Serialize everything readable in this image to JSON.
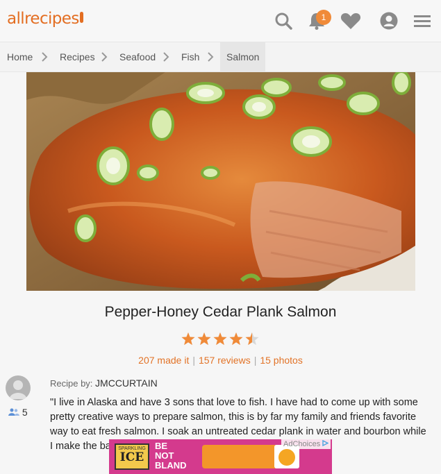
{
  "header": {
    "logo_text": "allrecipes",
    "notification_count": "1",
    "icons": [
      "search-icon",
      "bell-icon",
      "heart-icon",
      "user-icon",
      "menu-icon"
    ]
  },
  "breadcrumb": [
    {
      "label": "Home"
    },
    {
      "label": "Recipes"
    },
    {
      "label": "Seafood"
    },
    {
      "label": "Fish"
    },
    {
      "label": "Salmon"
    }
  ],
  "recipe": {
    "title": "Pepper-Honey Cedar Plank Salmon",
    "rating": 4.5,
    "made_it": "207 made it",
    "reviews": "157 reviews",
    "photos": "15 photos",
    "sep": "|",
    "byline_label": "Recipe by:",
    "author": "JMCCURTAIN",
    "followers": "5",
    "description": "\"I live in Alaska and have 3 sons that love to fish. I have had to come up with some pretty creative ways to prepare salmon, this is by far my family and friends favorite way to eat fresh salmon. I soak an untreated cedar plank in water and bourbon while I make the barbeque sauce so that's it is ready"
  },
  "ad": {
    "brand": "ICE",
    "brand_top": "SPARKLING",
    "slogan_1": "BE",
    "slogan_2": "NOT",
    "slogan_3": "BLAND",
    "adchoices": "AdChoices"
  },
  "colors": {
    "accent": "#e27327",
    "badge": "#f08a38",
    "star": "#f08a38",
    "ad_bg": "#d43a8d"
  }
}
